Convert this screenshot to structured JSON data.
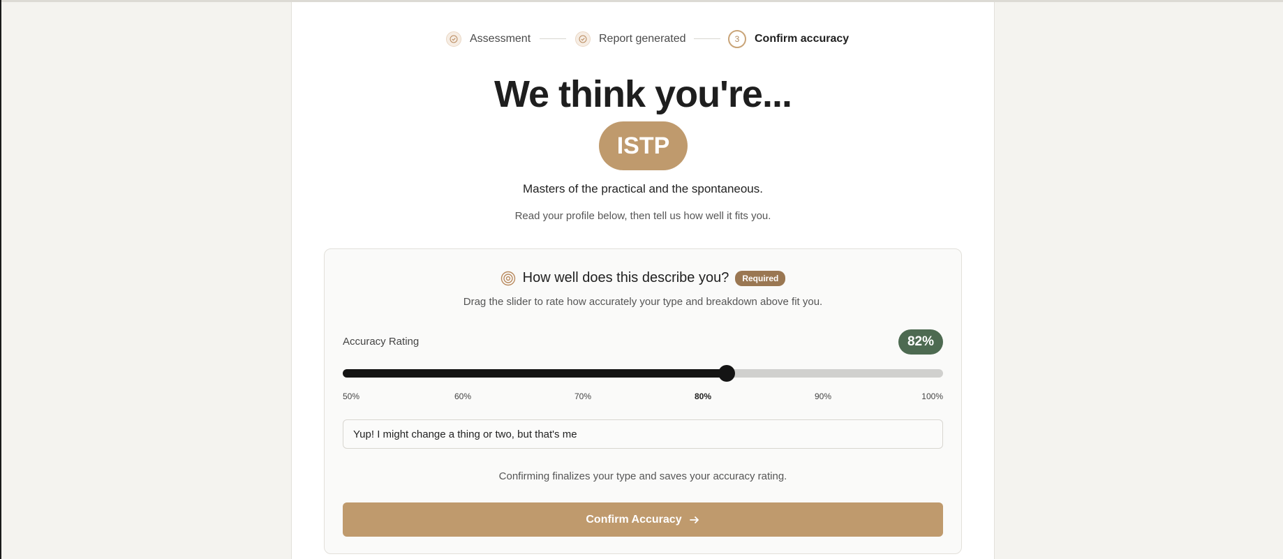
{
  "stepper": {
    "steps": [
      {
        "label": "Assessment",
        "status": "done",
        "icon": "check-icon"
      },
      {
        "label": "Report generated",
        "status": "done",
        "icon": "check-icon"
      },
      {
        "label": "Confirm accuracy",
        "status": "current",
        "number": "3"
      }
    ]
  },
  "hero": {
    "title": "We think you're...",
    "type_code": "ISTP",
    "tagline": "Masters of the practical and the spontaneous.",
    "instruction": "Read your profile below, then tell us how well it fits you."
  },
  "rating_card": {
    "icon": "target-icon",
    "question": "How well does this describe you?",
    "required_badge": "Required",
    "description": "Drag the slider to rate how accurately your type and breakdown above fit you.",
    "label": "Accuracy Rating",
    "value_text": "82%",
    "value": 82,
    "min": 50,
    "max": 100,
    "ticks": [
      {
        "label": "50%",
        "value": 50
      },
      {
        "label": "60%",
        "value": 60
      },
      {
        "label": "70%",
        "value": 70
      },
      {
        "label": "80%",
        "value": 80,
        "active": true
      },
      {
        "label": "90%",
        "value": 90
      },
      {
        "label": "100%",
        "value": 100
      }
    ],
    "feedback_text": "Yup! I might change a thing or two, but that's me",
    "confirm_note": "Confirming finalizes your type and saves your accuracy rating.",
    "confirm_button_label": "Confirm Accuracy",
    "confirm_button_icon": "arrow-right-icon"
  },
  "colors": {
    "accent": "#bf9a6d",
    "badge": "#9a7752",
    "rating_pill": "#4d6a51",
    "slider_fill": "#141414"
  }
}
